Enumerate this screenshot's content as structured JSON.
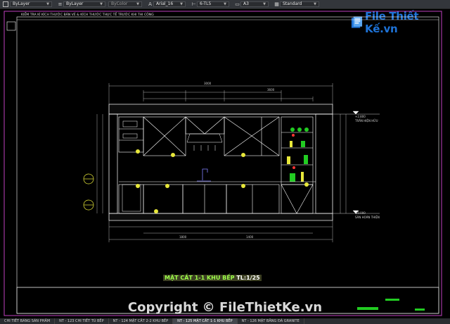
{
  "toolbar": {
    "layer_a": "ByLayer",
    "layer_b": "ByLayer",
    "color": "ByColor",
    "text_style": "Arial_16",
    "dim_style": "6-TL5",
    "paper": "A3",
    "table_style": "Standard"
  },
  "logo": {
    "text": "File Thiết Kế.vn"
  },
  "drawing": {
    "header_note": "KIỂM TRA KÍ KÍCH THƯỚC BẢN VẼ & KÍCH THƯỚC THỰC TẾ TRƯỚC KHI THI CÔNG",
    "section_title_main": "MẶT CẮT 1-1 KHU BẾP",
    "section_title_scale": "TL:1/25",
    "ceiling_label": "TRẦN HIỆN HỮU",
    "floor_label": "SÀN HOÀN THIỆN",
    "ceiling_level": "+2.800",
    "floor_level": "±0.000",
    "top_dims": [
      "3000",
      "3600"
    ],
    "bottom_dims": [
      "1800",
      "1400"
    ]
  },
  "watermark": "Copyright © FileThietKe.vn",
  "tabs": [
    {
      "label": "CHI TIẾT BẢNG SẢN PHẨM",
      "active": false
    },
    {
      "label": "NT - 123 CHI TIẾT TỦ BẾP",
      "active": false
    },
    {
      "label": "NT - 124 MẶT CẮT 2-2 KHU BẾP",
      "active": false
    },
    {
      "label": "NT - 125 MẶT CẮT 1-1 KHU BẾP",
      "active": true
    },
    {
      "label": "NT - 126 MẶT BẰNG ĐÁ GRANITE",
      "active": false
    }
  ],
  "colors": {
    "frame": "#c040c0",
    "cabinet_line": "#ffffff",
    "dim_line": "#e0e0e0",
    "accent_green": "#22cc22",
    "accent_yellow": "#e8e83a",
    "toolbar_bg": "#33363b",
    "logo_blue": "#1e73d8"
  }
}
